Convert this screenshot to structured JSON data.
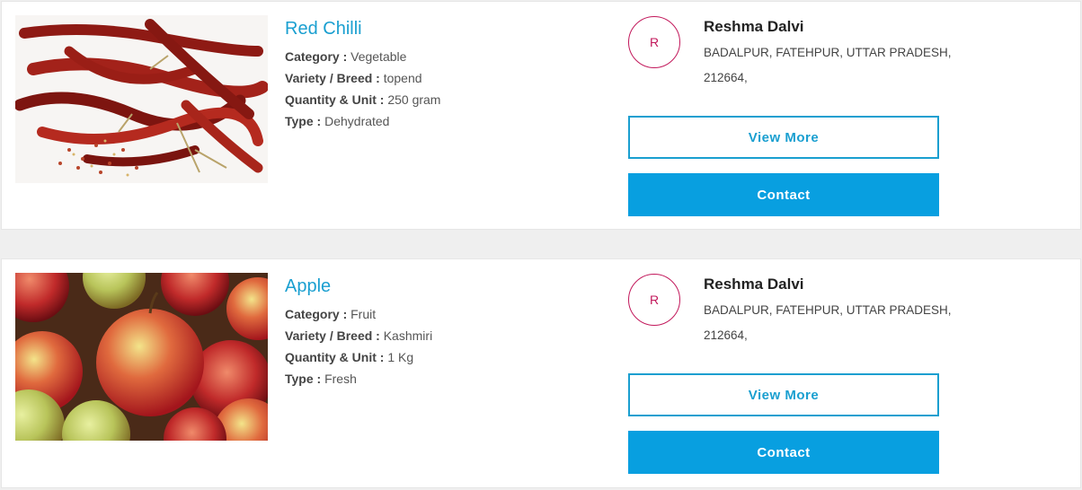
{
  "listings": [
    {
      "title": "Red Chilli",
      "image": "red-chilli-photo",
      "specs": [
        {
          "label": "Category :",
          "value": "Vegetable"
        },
        {
          "label": "Variety / Breed :",
          "value": "topend"
        },
        {
          "label": "Quantity & Unit :",
          "value": "250 gram"
        },
        {
          "label": "Type :",
          "value": "Dehydrated"
        }
      ],
      "seller": {
        "initial": "R",
        "name": "Reshma Dalvi",
        "address_line1": "BADALPUR, FATEHPUR, UTTAR PRADESH,",
        "address_line2": "212664,"
      },
      "view_more_label": "View More",
      "contact_label": "Contact"
    },
    {
      "title": "Apple",
      "image": "apple-photo",
      "specs": [
        {
          "label": "Category :",
          "value": "Fruit"
        },
        {
          "label": "Variety / Breed :",
          "value": "Kashmiri"
        },
        {
          "label": "Quantity & Unit :",
          "value": "1 Kg"
        },
        {
          "label": "Type :",
          "value": "Fresh"
        }
      ],
      "seller": {
        "initial": "R",
        "name": "Reshma Dalvi",
        "address_line1": "BADALPUR, FATEHPUR, UTTAR PRADESH,",
        "address_line2": "212664,"
      },
      "view_more_label": "View More",
      "contact_label": "Contact"
    }
  ],
  "colors": {
    "accent": "#1a9fd0",
    "contact_button": "#089fe0",
    "avatar_ring": "#c2185b",
    "page_background": "#efefef"
  }
}
